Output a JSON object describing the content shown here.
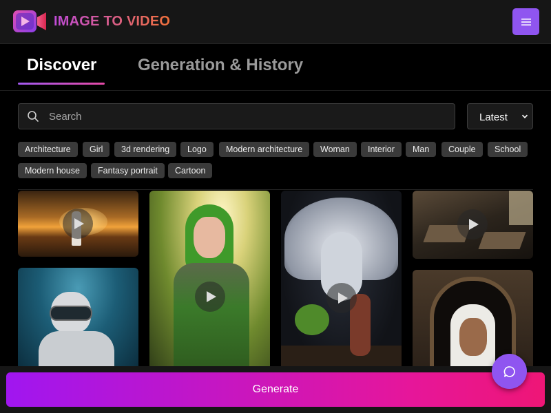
{
  "app": {
    "brand": "IMAGE TO VIDEO"
  },
  "header": {
    "menu_icon": "hamburger-menu-icon"
  },
  "tabs": [
    {
      "label": "Discover",
      "active": true
    },
    {
      "label": "Generation & History",
      "active": false
    }
  ],
  "search": {
    "placeholder": "Search",
    "value": ""
  },
  "sort": {
    "selected": "Latest"
  },
  "tags": [
    "Architecture",
    "Girl",
    "3d rendering",
    "Logo",
    "Modern architecture",
    "Woman",
    "Interior",
    "Man",
    "Couple",
    "School",
    "Modern house",
    "Fantasy portrait",
    "Cartoon"
  ],
  "gallery": [
    {
      "subject": "desert-sunset",
      "has_play": true
    },
    {
      "subject": "diver-cat",
      "has_play": false
    },
    {
      "subject": "elf-warrior",
      "has_play": true
    },
    {
      "subject": "eagle-tree",
      "has_play": true
    },
    {
      "subject": "library-interior",
      "has_play": true
    },
    {
      "subject": "arab-portrait",
      "has_play": false
    }
  ],
  "footer": {
    "generate_label": "Generate",
    "chat_icon": "chat-bubble-icon"
  },
  "colors": {
    "accent": "#8f55f0",
    "gradient_start": "#a016f0",
    "gradient_end": "#ee1676"
  }
}
